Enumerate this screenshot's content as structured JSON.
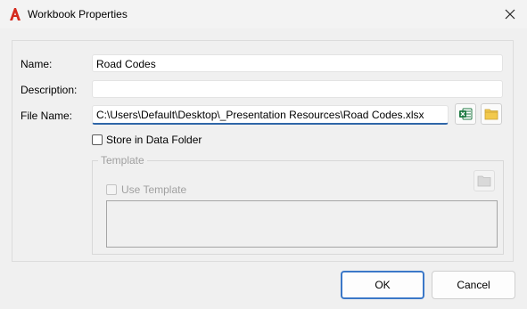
{
  "window": {
    "title": "Workbook Properties",
    "logo_icon": "autocad-a-icon",
    "close_icon": "close-icon"
  },
  "fields": {
    "name_label": "Name:",
    "name_value": "Road Codes",
    "description_label": "Description:",
    "description_value": "",
    "file_name_label": "File Name:",
    "file_name_value": "C:\\Users\\Default\\Desktop\\_Presentation Resources\\Road Codes.xlsx"
  },
  "file_buttons": {
    "excel_icon": "excel-icon",
    "browse_icon": "folder-icon"
  },
  "store_in_data_folder": {
    "label": "Store in Data Folder",
    "checked": false
  },
  "template_group": {
    "title": "Template",
    "use_template_label": "Use Template",
    "use_template_checked": false,
    "enabled": false,
    "browse_icon": "folder-icon"
  },
  "buttons": {
    "ok_label": "OK",
    "cancel_label": "Cancel"
  },
  "colors": {
    "accent": "#2f66a8",
    "logo_red": "#d52b1e",
    "excel_green": "#1f7a43",
    "folder_yellow": "#f2c94c"
  }
}
